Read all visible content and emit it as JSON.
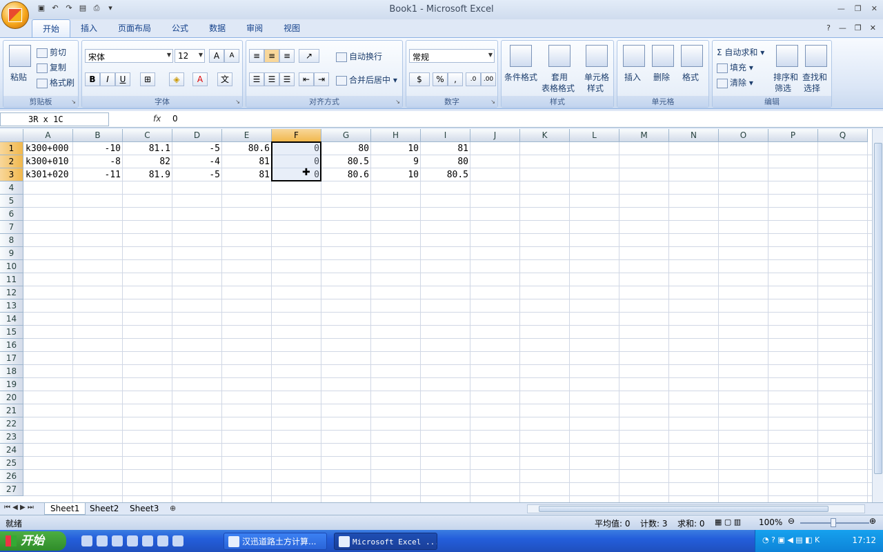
{
  "window": {
    "title": "Book1 - Microsoft Excel"
  },
  "ribbon": {
    "tabs": [
      "开始",
      "插入",
      "页面布局",
      "公式",
      "数据",
      "审阅",
      "视图"
    ],
    "clipboard": {
      "label": "剪贴板",
      "paste": "粘贴",
      "cut": "剪切",
      "copy": "复制",
      "format_painter": "格式刷"
    },
    "font": {
      "label": "字体",
      "name": "宋体",
      "size": "12"
    },
    "alignment": {
      "label": "对齐方式",
      "wrap": "自动换行",
      "merge": "合并后居中"
    },
    "number": {
      "label": "数字",
      "format": "常规"
    },
    "styles": {
      "label": "样式",
      "conditional": "条件格式",
      "table_1": "套用",
      "table_2": "表格格式",
      "cell_1": "单元格",
      "cell_2": "样式"
    },
    "cells": {
      "label": "单元格",
      "insert": "插入",
      "delete": "删除",
      "format": "格式"
    },
    "editing": {
      "label": "编辑",
      "autosum": "自动求和",
      "fill": "填充",
      "clear": "清除",
      "sort_1": "排序和",
      "sort_2": "筛选",
      "find_1": "查找和",
      "find_2": "选择"
    }
  },
  "formula_bar": {
    "name_box": "3R x 1C",
    "fx": "fx",
    "content": "0"
  },
  "grid": {
    "columns": [
      "A",
      "B",
      "C",
      "D",
      "E",
      "F",
      "G",
      "H",
      "I",
      "J",
      "K",
      "L",
      "M",
      "N",
      "O",
      "P",
      "Q"
    ],
    "selected_column": "F",
    "rows": [
      "1",
      "2",
      "3",
      "4",
      "5",
      "6",
      "7",
      "8",
      "9",
      "10",
      "11",
      "12",
      "13",
      "14",
      "15",
      "16",
      "17",
      "18",
      "19",
      "20",
      "21",
      "22",
      "23",
      "24",
      "25",
      "26",
      "27"
    ],
    "data": [
      [
        "k300+000",
        "-10",
        "81.1",
        "-5",
        "80.6",
        "0",
        "80",
        "10",
        "81"
      ],
      [
        "k300+010",
        "-8",
        "82",
        "-4",
        "81",
        "0",
        "80.5",
        "9",
        "80"
      ],
      [
        "k301+020",
        "-11",
        "81.9",
        "-5",
        "81",
        "0",
        "80.6",
        "10",
        "80.5"
      ]
    ]
  },
  "sheets": [
    "Sheet1",
    "Sheet2",
    "Sheet3"
  ],
  "active_sheet": "Sheet1",
  "status": {
    "ready": "就绪",
    "average": "平均值: 0",
    "count": "计数: 3",
    "sum": "求和: 0",
    "zoom": "100%"
  },
  "taskbar": {
    "start": "开始",
    "tasks": [
      "汉迅道路土方计算...",
      "Microsoft Excel ..."
    ],
    "clock": "17:12"
  },
  "colors": {
    "accent": "#15428b",
    "selection_header": "#f1b84d",
    "taskbar": "#245edb"
  }
}
